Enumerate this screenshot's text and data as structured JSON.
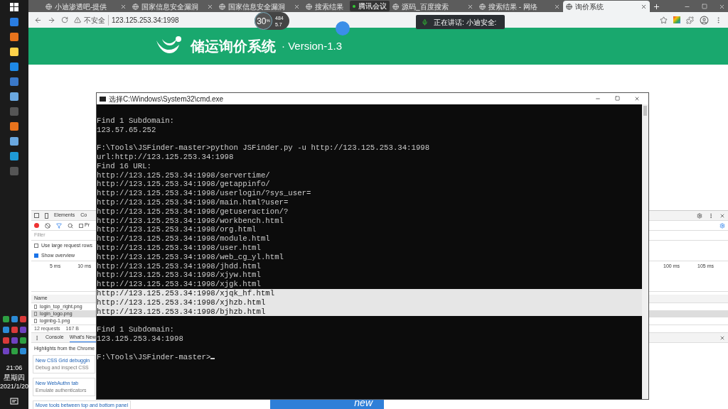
{
  "taskbar": {
    "time": "21:06",
    "weekday": "星期四",
    "date": "2021/1/20"
  },
  "browser": {
    "tabs": [
      {
        "title": "小迪渗透吧-提供",
        "selected": false
      },
      {
        "title": "国家信息安全漏洞",
        "selected": false
      },
      {
        "title": "国家信息安全漏洞",
        "selected": false
      },
      {
        "title": "搜索结果",
        "selected": false
      },
      {
        "title": "源码_百度搜索",
        "selected": false
      },
      {
        "title": "搜索结果 - 网络",
        "selected": false
      },
      {
        "title": "询价系统",
        "selected": true
      }
    ],
    "security": "不安全",
    "url": "123.125.253.34:1998"
  },
  "page": {
    "title": "储运询价系统",
    "version": "· Version-1.3",
    "badge": "new"
  },
  "devtools": {
    "tabs": [
      "Elements",
      "Co"
    ],
    "toolbar_checkbox": {
      "label": "Pr",
      "checked": false
    },
    "filter_placeholder": "Filter",
    "options": [
      {
        "label": "Use large request rows",
        "checked": false
      },
      {
        "label": "Show overview",
        "checked": true
      }
    ],
    "ticks_left": [
      "5 ms",
      "10 ms"
    ],
    "ticks_right": [
      "100 ms",
      "105 ms"
    ],
    "name_header": "Name",
    "files": [
      "login_top_right.png",
      "login_logo.png",
      "loginbg-1.png"
    ],
    "summary": [
      "12 requests",
      "167 B"
    ],
    "drawer_tabs": [
      {
        "label": "Console",
        "selected": false
      },
      {
        "label": "What's New",
        "selected": true
      }
    ],
    "highlights": "Highlights from the Chrome",
    "cards": [
      {
        "title": "New CSS Grid debuggin",
        "text": "Debug and inspect CSS"
      },
      {
        "title": "New WebAuthn tab",
        "text": "Emulate authenticators"
      },
      {
        "title": "Move tools between top and bottom panel"
      }
    ]
  },
  "cmd": {
    "title": "选择C:\\Windows\\System32\\cmd.exe",
    "lines": [
      {
        "selected": false
      },
      {
        "text": "Find 1 Subdomain:",
        "selected": false
      },
      {
        "text": "123.57.65.252",
        "selected": false
      },
      {
        "selected": false
      },
      {
        "text": "F:\\Tools\\JSFinder-master>python JSFinder.py -u http://123.125.253.34:1998",
        "selected": false
      },
      {
        "text": "url:http://123.125.253.34:1998",
        "selected": false
      },
      {
        "text": "Find 16 URL:",
        "selected": false
      },
      {
        "text": "http://123.125.253.34:1998/servertime/",
        "selected": false
      },
      {
        "text": "http://123.125.253.34:1998/getappinfo/",
        "selected": false
      },
      {
        "text": "http://123.125.253.34:1998/userlogin/?sys_user=",
        "selected": false
      },
      {
        "text": "http://123.125.253.34:1998/main.html?user=",
        "selected": false
      },
      {
        "text": "http://123.125.253.34:1998/getuseraction/?",
        "selected": false
      },
      {
        "text": "http://123.125.253.34:1998/workbench.html",
        "selected": false
      },
      {
        "text": "http://123.125.253.34:1998/org.html",
        "selected": false
      },
      {
        "text": "http://123.125.253.34:1998/module.html",
        "selected": false
      },
      {
        "text": "http://123.125.253.34:1998/user.html",
        "selected": false
      },
      {
        "text": "http://123.125.253.34:1998/web_cg_yl.html",
        "selected": false
      },
      {
        "text": "http://123.125.253.34:1998/jhdd.html",
        "selected": false
      },
      {
        "text": "http://123.125.253.34:1998/xjyw.html",
        "selected": false
      },
      {
        "text": "http://123.125.253.34:1998/xjgk.html",
        "selected": false
      },
      {
        "text": "http://123.125.253.34:1998/xjqk_hf.html",
        "selected": true
      },
      {
        "text": "http://123.125.253.34:1998/xjhzb.html",
        "selected": true
      },
      {
        "text": "http://123.125.253.34:1998/bjhzb.html",
        "selected": true
      },
      {
        "selected": false
      },
      {
        "text": "Find 1 Subdomain:",
        "selected": false
      },
      {
        "text": "123.125.253.34:1998",
        "selected": false
      },
      {
        "selected": false
      },
      {
        "text": "F:\\Tools\\JSFinder-master>",
        "selected": false
      }
    ]
  },
  "overlays": {
    "meeting": "腾讯会议",
    "speaking": "正在讲话: 小迪安全:",
    "speed": {
      "percent": "30",
      "unit": "%",
      "up": "484",
      "down": "5.7"
    }
  }
}
